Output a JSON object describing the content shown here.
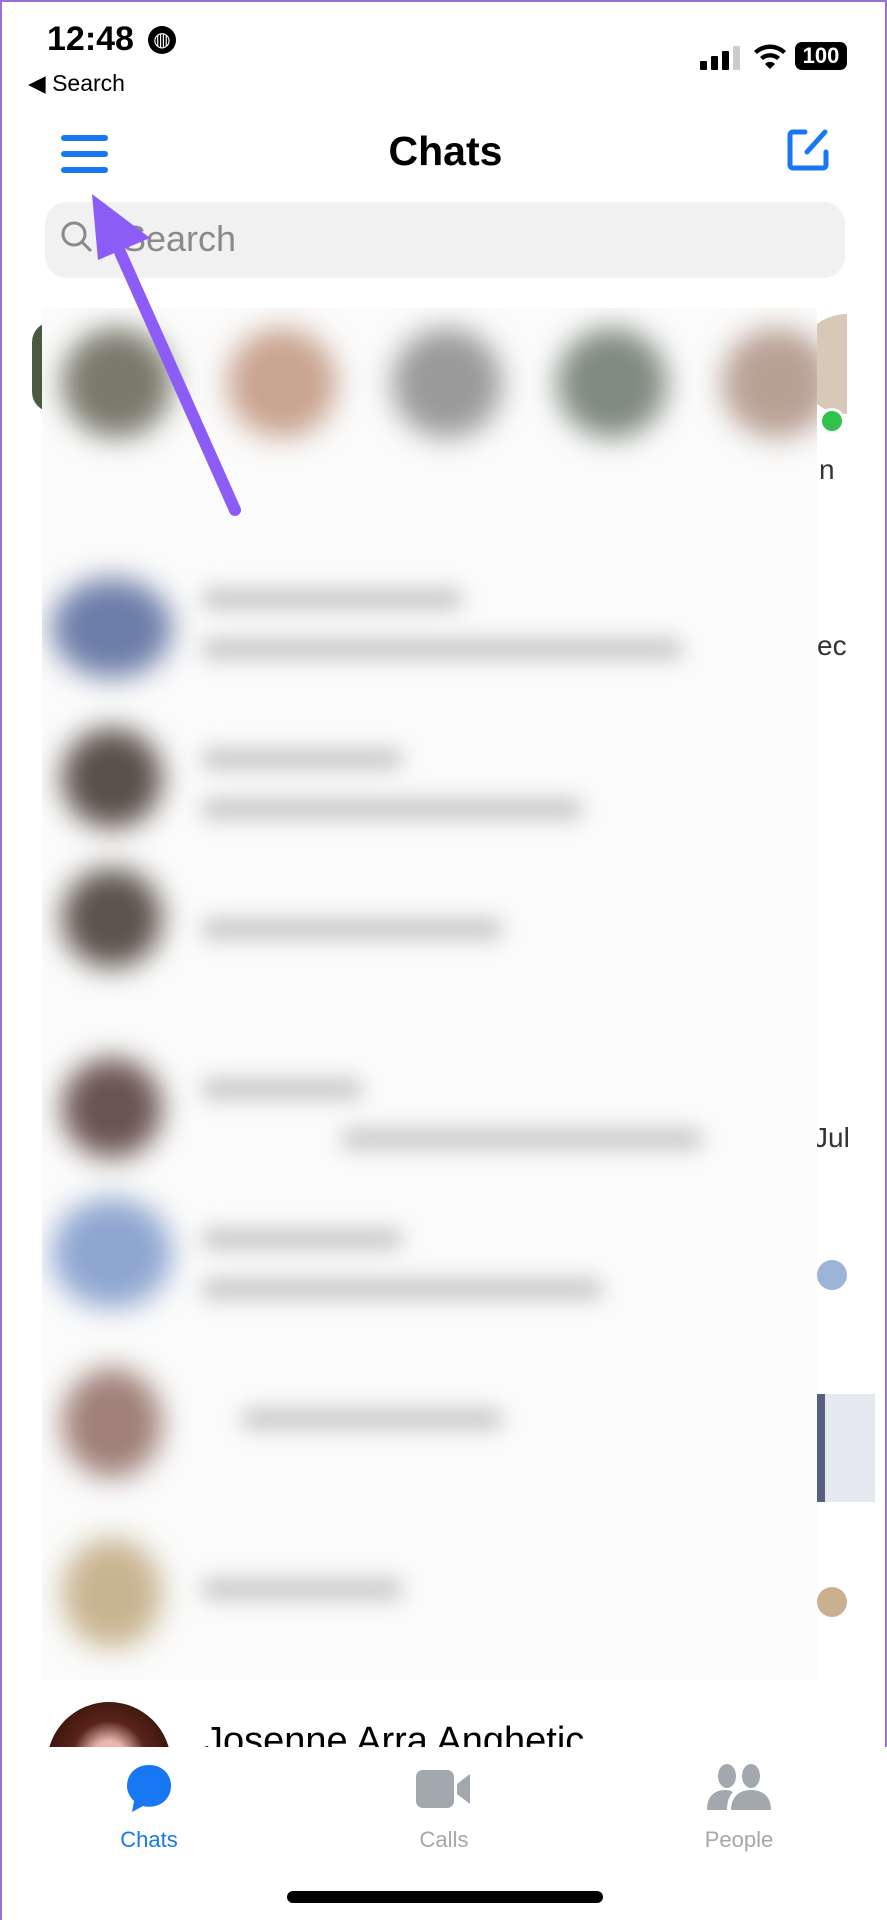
{
  "status_bar": {
    "time": "12:48",
    "back_label": "Search",
    "battery": "100"
  },
  "header": {
    "title": "Chats"
  },
  "search": {
    "placeholder": "Search"
  },
  "partial_text": {
    "story_name_fragment": "n",
    "row2_time_fragment": "ec",
    "row5_time_fragment": "Jul"
  },
  "last_visible_chat": {
    "name": "Josenne Arra Anghetic"
  },
  "tabs": [
    {
      "label": "Chats",
      "active": true
    },
    {
      "label": "Calls",
      "active": false
    },
    {
      "label": "People",
      "active": false
    }
  ],
  "colors": {
    "accent": "#1877f2",
    "inactive": "#a3a7ae",
    "annotation_arrow": "#8b5cf6",
    "online": "#31c24d"
  }
}
